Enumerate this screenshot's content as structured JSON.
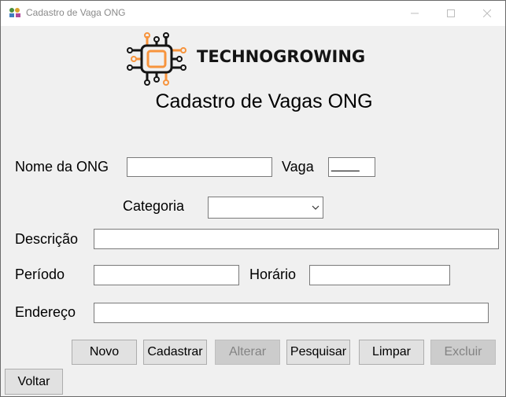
{
  "window": {
    "title": "Cadastro de Vaga ONG",
    "icon": "app-icon",
    "controls": {
      "minimize_icon": "minimize-icon",
      "maximize_icon": "maximize-icon",
      "close_icon": "close-icon"
    }
  },
  "header": {
    "logo_text": "TECHNOGROWING",
    "logo_icon": "chip-icon",
    "form_title": "Cadastro de Vagas ONG"
  },
  "form": {
    "nome_ong": {
      "label": "Nome da ONG",
      "value": ""
    },
    "vaga": {
      "label": "Vaga",
      "value": "____"
    },
    "categoria": {
      "label": "Categoria",
      "selected": ""
    },
    "descricao": {
      "label": "Descrição",
      "value": ""
    },
    "periodo": {
      "label": "Período",
      "value": ""
    },
    "horario": {
      "label": "Horário",
      "value": ""
    },
    "endereco": {
      "label": "Endereço",
      "value": ""
    }
  },
  "buttons": {
    "novo": "Novo",
    "cadastrar": "Cadastrar",
    "alterar": "Alterar",
    "pesquisar": "Pesquisar",
    "limpar": "Limpar",
    "excluir": "Excluir",
    "voltar": "Voltar"
  },
  "colors": {
    "accent_orange": "#f7943d",
    "logo_dark": "#141414",
    "window_bg": "#f0f0f0",
    "disabled_button": "#cccccc"
  }
}
